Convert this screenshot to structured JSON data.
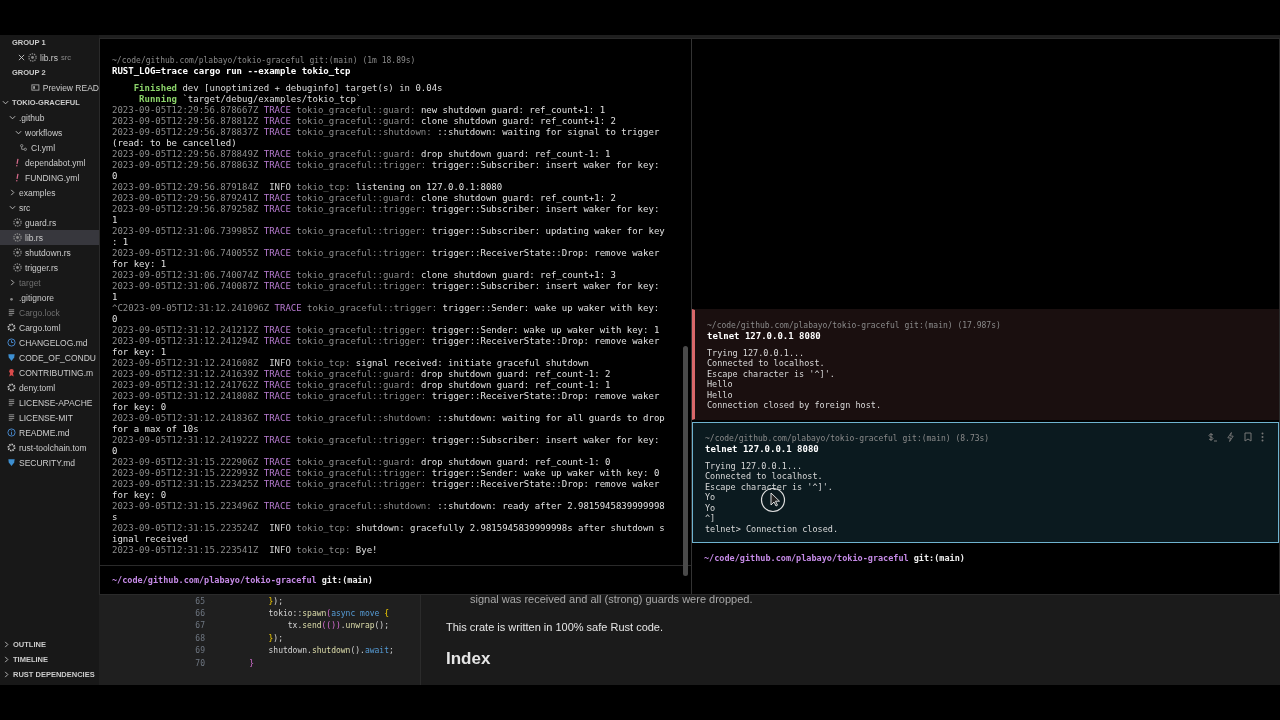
{
  "sidebar": {
    "groups": [
      {
        "title": "GROUP 1",
        "items": [
          {
            "label": "lib.rs",
            "detail": "src",
            "kind": "rust",
            "closable": true
          }
        ]
      },
      {
        "title": "GROUP 2",
        "items": [
          {
            "label": "Preview READ",
            "kind": "preview",
            "closable": false
          }
        ]
      }
    ],
    "explorer": {
      "title": "TOKIO-GRACEFUL",
      "expanded": true,
      "tree": [
        {
          "label": ".github",
          "kind": "folder",
          "expanded": true,
          "selected": false,
          "ignored": false,
          "children": [
            {
              "label": "workflows",
              "kind": "folder",
              "expanded": true,
              "selected": false,
              "ignored": false,
              "children": [
                {
                  "label": "CI.yml",
                  "kind": "workflow",
                  "selected": false,
                  "ignored": false
                }
              ]
            },
            {
              "label": "dependabot.yml",
              "kind": "yaml",
              "selected": false,
              "ignored": false
            },
            {
              "label": "FUNDING.yml",
              "kind": "yaml",
              "selected": false,
              "ignored": false
            }
          ]
        },
        {
          "label": "examples",
          "kind": "folder",
          "expanded": false,
          "selected": false,
          "ignored": false
        },
        {
          "label": "src",
          "kind": "folder",
          "expanded": true,
          "selected": false,
          "ignored": false,
          "children": [
            {
              "label": "guard.rs",
              "kind": "rust",
              "selected": false,
              "ignored": false
            },
            {
              "label": "lib.rs",
              "kind": "rust",
              "selected": true,
              "ignored": false
            },
            {
              "label": "shutdown.rs",
              "kind": "rust",
              "selected": false,
              "ignored": false
            },
            {
              "label": "trigger.rs",
              "kind": "rust",
              "selected": false,
              "ignored": false
            }
          ]
        },
        {
          "label": "target",
          "kind": "folder",
          "expanded": false,
          "selected": false,
          "ignored": true
        },
        {
          "label": ".gitignore",
          "kind": "git",
          "selected": false,
          "ignored": false
        },
        {
          "label": "Cargo.lock",
          "kind": "text",
          "selected": false,
          "ignored": true
        },
        {
          "label": "Cargo.toml",
          "kind": "gear",
          "selected": false,
          "ignored": false
        },
        {
          "label": "CHANGELOG.md",
          "kind": "clock",
          "selected": false,
          "ignored": false
        },
        {
          "label": "CODE_OF_CONDU",
          "kind": "shield",
          "selected": false,
          "ignored": false
        },
        {
          "label": "CONTRIBUTING.m",
          "kind": "ribbon",
          "selected": false,
          "ignored": false
        },
        {
          "label": "deny.toml",
          "kind": "gear",
          "selected": false,
          "ignored": false
        },
        {
          "label": "LICENSE-APACHE",
          "kind": "text",
          "selected": false,
          "ignored": false
        },
        {
          "label": "LICENSE-MIT",
          "kind": "text",
          "selected": false,
          "ignored": false
        },
        {
          "label": "README.md",
          "kind": "info",
          "selected": false,
          "ignored": false
        },
        {
          "label": "rust-toolchain.tom",
          "kind": "gear",
          "selected": false,
          "ignored": false
        },
        {
          "label": "SECURITY.md",
          "kind": "shield",
          "selected": false,
          "ignored": false
        }
      ]
    },
    "sections": [
      {
        "title": "OUTLINE",
        "expanded": false
      },
      {
        "title": "TIMELINE",
        "expanded": false
      },
      {
        "title": "RUST DEPENDENCIES",
        "expanded": false
      }
    ]
  },
  "editor": {
    "lines": [
      {
        "number": "65",
        "tokens": [
          {
            "text": "        }",
            "kind": "brace"
          },
          {
            "text": ");",
            "kind": "plain"
          }
        ]
      },
      {
        "number": "66",
        "tokens": [
          {
            "text": "        tokio::",
            "kind": "plain"
          },
          {
            "text": "spawn",
            "kind": "fn"
          },
          {
            "text": "(",
            "kind": "paren"
          },
          {
            "text": "async move",
            "kind": "keyword"
          },
          {
            "text": " {",
            "kind": "brace"
          }
        ]
      },
      {
        "number": "67",
        "tokens": [
          {
            "text": "            tx.",
            "kind": "plain"
          },
          {
            "text": "send",
            "kind": "fn"
          },
          {
            "text": "(())",
            "kind": "paren"
          },
          {
            "text": ".",
            "kind": "plain"
          },
          {
            "text": "unwrap",
            "kind": "fn"
          },
          {
            "text": "();",
            "kind": "plain"
          }
        ]
      },
      {
        "number": "68",
        "tokens": [
          {
            "text": "        }",
            "kind": "brace"
          },
          {
            "text": ");",
            "kind": "plain"
          }
        ]
      },
      {
        "number": "69",
        "tokens": [
          {
            "text": "        shutdown.",
            "kind": "plain"
          },
          {
            "text": "shutdown",
            "kind": "fn"
          },
          {
            "text": "().",
            "kind": "plain"
          },
          {
            "text": "await",
            "kind": "keyword"
          },
          {
            "text": ";",
            "kind": "plain"
          }
        ]
      },
      {
        "number": "70",
        "tokens": [
          {
            "text": "    }",
            "kind": "paren"
          }
        ]
      }
    ]
  },
  "preview": [
    {
      "kind": "indented",
      "text": "signal was received and all (strong) guards were dropped."
    },
    {
      "kind": "paragraph",
      "text": "This crate is written in 100% safe Rust code."
    },
    {
      "kind": "heading",
      "text": "Index"
    }
  ],
  "terminal": {
    "header": "~/code/github.com/plabayo/tokio-graceful git:(main) (1m 18.89s)",
    "command": "RUST_LOG=trace cargo run --example tokio_tcp",
    "cargo": [
      {
        "status": "    Finished",
        "text": " dev [unoptimized + debuginfo] target(s) in 0.04s"
      },
      {
        "status": "     Running",
        "text": " `target/debug/examples/tokio_tcp`"
      }
    ],
    "logs": [
      {
        "time": "2023-09-05T12:29:56.878667Z",
        "level": "TRACE",
        "target": "tokio_graceful::guard:",
        "message": "new shutdown guard: ref_count+1: 1"
      },
      {
        "time": "2023-09-05T12:29:56.878812Z",
        "level": "TRACE",
        "target": "tokio_graceful::guard:",
        "message": "clone shutdown guard: ref_count+1: 2"
      },
      {
        "time": "2023-09-05T12:29:56.878837Z",
        "level": "TRACE",
        "target": "tokio_graceful::shutdown:",
        "message": "::shutdown: waiting for signal to trigger (read: to be cancelled)"
      },
      {
        "time": "2023-09-05T12:29:56.878849Z",
        "level": "TRACE",
        "target": "tokio_graceful::guard:",
        "message": "drop shutdown guard: ref_count-1: 1"
      },
      {
        "time": "2023-09-05T12:29:56.878863Z",
        "level": "TRACE",
        "target": "tokio_graceful::trigger:",
        "message": "trigger::Subscriber: insert waker for key: 0"
      },
      {
        "time": "2023-09-05T12:29:56.879184Z",
        "level": "INFO",
        "target": "tokio_tcp:",
        "message": "listening on 127.0.0.1:8080"
      },
      {
        "time": "2023-09-05T12:29:56.879241Z",
        "level": "TRACE",
        "target": "tokio_graceful::guard:",
        "message": "clone shutdown guard: ref_count+1: 2"
      },
      {
        "time": "2023-09-05T12:29:56.879258Z",
        "level": "TRACE",
        "target": "tokio_graceful::trigger:",
        "message": "trigger::Subscriber: insert waker for key: 1"
      },
      {
        "time": "2023-09-05T12:31:06.739985Z",
        "level": "TRACE",
        "target": "tokio_graceful::trigger:",
        "message": "trigger::Subscriber: updating waker for key: 1"
      },
      {
        "time": "2023-09-05T12:31:06.740055Z",
        "level": "TRACE",
        "target": "tokio_graceful::trigger:",
        "message": "trigger::ReceiverState::Drop: remove waker for key: 1"
      },
      {
        "time": "2023-09-05T12:31:06.740074Z",
        "level": "TRACE",
        "target": "tokio_graceful::guard:",
        "message": "clone shutdown guard: ref_count+1: 3"
      },
      {
        "time": "2023-09-05T12:31:06.740087Z",
        "level": "TRACE",
        "target": "tokio_graceful::trigger:",
        "message": "trigger::Subscriber: insert waker for key: 1"
      },
      {
        "time": "^C2023-09-05T12:31:12.241096Z",
        "level": "TRACE",
        "target": "tokio_graceful::trigger:",
        "message": "trigger::Sender: wake up waker with key: 0"
      },
      {
        "time": "2023-09-05T12:31:12.241212Z",
        "level": "TRACE",
        "target": "tokio_graceful::trigger:",
        "message": "trigger::Sender: wake up waker with key: 1"
      },
      {
        "time": "2023-09-05T12:31:12.241294Z",
        "level": "TRACE",
        "target": "tokio_graceful::trigger:",
        "message": "trigger::ReceiverState::Drop: remove waker for key: 1"
      },
      {
        "time": "2023-09-05T12:31:12.241608Z",
        "level": "INFO",
        "target": "tokio_tcp:",
        "message": "signal received: initiate graceful shutdown"
      },
      {
        "time": "2023-09-05T12:31:12.241639Z",
        "level": "TRACE",
        "target": "tokio_graceful::guard:",
        "message": "drop shutdown guard: ref_count-1: 2"
      },
      {
        "time": "2023-09-05T12:31:12.241762Z",
        "level": "TRACE",
        "target": "tokio_graceful::guard:",
        "message": "drop shutdown guard: ref_count-1: 1"
      },
      {
        "time": "2023-09-05T12:31:12.241808Z",
        "level": "TRACE",
        "target": "tokio_graceful::trigger:",
        "message": "trigger::ReceiverState::Drop: remove waker for key: 0"
      },
      {
        "time": "2023-09-05T12:31:12.241836Z",
        "level": "TRACE",
        "target": "tokio_graceful::shutdown:",
        "message": "::shutdown: waiting for all guards to drop for a max of 10s"
      },
      {
        "time": "2023-09-05T12:31:12.241922Z",
        "level": "TRACE",
        "target": "tokio_graceful::trigger:",
        "message": "trigger::Subscriber: insert waker for key: 0"
      },
      {
        "time": "2023-09-05T12:31:15.222906Z",
        "level": "TRACE",
        "target": "tokio_graceful::guard:",
        "message": "drop shutdown guard: ref_count-1: 0"
      },
      {
        "time": "2023-09-05T12:31:15.222993Z",
        "level": "TRACE",
        "target": "tokio_graceful::trigger:",
        "message": "trigger::Sender: wake up waker with key: 0"
      },
      {
        "time": "2023-09-05T12:31:15.223425Z",
        "level": "TRACE",
        "target": "tokio_graceful::trigger:",
        "message": "trigger::ReceiverState::Drop: remove waker for key: 0"
      },
      {
        "time": "2023-09-05T12:31:15.223496Z",
        "level": "TRACE",
        "target": "tokio_graceful::shutdown:",
        "message": "::shutdown: ready after 2.9815945839999998s"
      },
      {
        "time": "2023-09-05T12:31:15.223524Z",
        "level": "INFO",
        "target": "tokio_tcp:",
        "message": "shutdown: gracefully 2.9815945839999998s after shutdown signal received"
      },
      {
        "time": "2023-09-05T12:31:15.223541Z",
        "level": "INFO",
        "target": "tokio_tcp:",
        "message": "Bye!"
      }
    ],
    "prompt": {
      "path": "~/code/github.com/plabayo/tokio-graceful",
      "branch": "git:(main)"
    }
  },
  "blocks": [
    {
      "header": "~/code/github.com/plabayo/tokio-graceful git:(main) (17.987s)",
      "command": "telnet 127.0.0.1 8080",
      "failed": true,
      "selected": false,
      "output": [
        "Trying 127.0.0.1...",
        "Connected to localhost.",
        "Escape character is '^]'.",
        "Hello",
        "Hello",
        "Connection closed by foreign host."
      ]
    },
    {
      "header": "~/code/github.com/plabayo/tokio-graceful git:(main) (8.73s)",
      "command": "telnet 127.0.0.1 8080",
      "failed": false,
      "selected": true,
      "output": [
        "Trying 127.0.0.1...",
        "Connected to localhost.",
        "Escape character is '^]'.",
        "Yo",
        "Yo",
        "^]",
        "telnet> Connection closed."
      ]
    }
  ],
  "right_prompt": {
    "path": "~/code/github.com/plabayo/tokio-graceful",
    "branch": "git:(main)"
  }
}
